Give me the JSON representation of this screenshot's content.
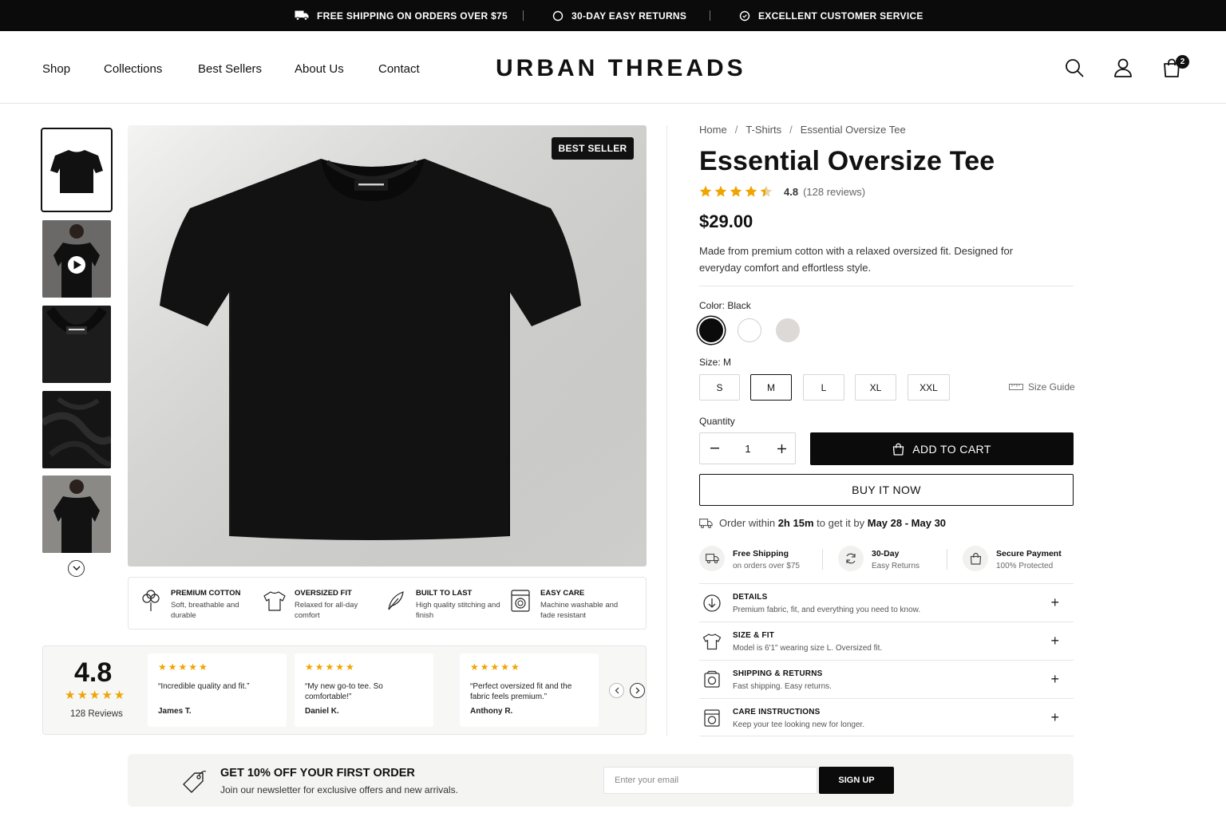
{
  "announcement": {
    "items": [
      {
        "icon": "truck-icon",
        "text": "FREE SHIPPING ON ORDERS OVER $75"
      },
      {
        "icon": "return-icon",
        "text": "30-DAY EASY RETURNS"
      },
      {
        "icon": "service-icon",
        "text": "EXCELLENT CUSTOMER SERVICE"
      }
    ]
  },
  "header": {
    "nav": [
      "Shop",
      "Collections",
      "Best Sellers",
      "About Us",
      "Contact"
    ],
    "logo": "URBAN THREADS",
    "cart_count": "2"
  },
  "gallery": {
    "thumbnails": [
      "tee-front",
      "model-video",
      "collar-detail",
      "fabric-closeup",
      "model-back"
    ],
    "badge": "BEST SELLER"
  },
  "features": [
    {
      "icon": "cotton-icon",
      "title": "PREMIUM COTTON",
      "desc": "Soft, breathable and durable"
    },
    {
      "icon": "tshirt-icon",
      "title": "OVERSIZED FIT",
      "desc": "Relaxed for all-day comfort"
    },
    {
      "icon": "feather-icon",
      "title": "BUILT TO LAST",
      "desc": "High quality stitching and finish"
    },
    {
      "icon": "washer-icon",
      "title": "EASY CARE",
      "desc": "Machine washable and fade resistant"
    }
  ],
  "reviews": {
    "average": "4.8",
    "stars": "★★★★★",
    "count_label": "128 Reviews",
    "items": [
      {
        "stars": "★★★★★",
        "quote": "“Incredible quality and fit.”",
        "author": "James T."
      },
      {
        "stars": "★★★★★",
        "quote": "“My new go-to tee. So comfortable!”",
        "author": "Daniel K."
      },
      {
        "stars": "★★★★★",
        "quote": "“Perfect oversized fit and the fabric feels premium.”",
        "author": "Anthony R."
      }
    ]
  },
  "product": {
    "breadcrumb": [
      "Home",
      "T-Shirts",
      "Essential Oversize Tee"
    ],
    "title": "Essential Oversize Tee",
    "rating": "4.8",
    "rating_stars": 4.8,
    "reviews_count": "(128 reviews)",
    "price": "$29.00",
    "description": "Made from premium cotton with a relaxed oversized fit. Designed for everyday comfort and effortless style.",
    "color_label": "Color: Black",
    "colors": [
      {
        "name": "Black",
        "hex": "#0b0b0b",
        "selected": true
      },
      {
        "name": "White",
        "hex": "#ffffff",
        "selected": false
      },
      {
        "name": "Stone",
        "hex": "#dcd9d6",
        "selected": false
      }
    ],
    "size_label": "Size: M",
    "sizes": [
      "S",
      "M",
      "L",
      "XL",
      "XXL"
    ],
    "selected_size": "M",
    "size_guide": "Size Guide",
    "quantity_label": "Quantity",
    "quantity": "1",
    "add_to_cart": "ADD TO CART",
    "buy_now": "BUY IT NOW",
    "delivery": {
      "pre": "Order within",
      "time": "2h 15m",
      "mid": "to get it by",
      "dates": "May 28 - May 30"
    }
  },
  "perks": [
    {
      "icon": "truck-icon",
      "title": "Free Shipping",
      "sub": "on orders over $75"
    },
    {
      "icon": "refresh-icon",
      "title": "30-Day",
      "sub": "Easy Returns"
    },
    {
      "icon": "lock-bag-icon",
      "title": "Secure Payment",
      "sub": "100% Protected"
    }
  ],
  "accordion": [
    {
      "icon": "arrow-down-circle-icon",
      "title": "DETAILS",
      "sub": "Premium fabric, fit, and everything you need to know."
    },
    {
      "icon": "tshirt-icon",
      "title": "SIZE & FIT",
      "sub": "Model is 6'1\" wearing size L. Oversized fit."
    },
    {
      "icon": "box-icon",
      "title": "SHIPPING & RETURNS",
      "sub": "Fast shipping. Easy returns."
    },
    {
      "icon": "washer-icon",
      "title": "CARE INSTRUCTIONS",
      "sub": "Keep your tee looking new for longer."
    }
  ],
  "newsletter": {
    "title": "GET 10% OFF YOUR FIRST ORDER",
    "desc": "Join our newsletter for exclusive offers and new arrivals.",
    "placeholder": "Enter your email",
    "button": "SIGN UP"
  },
  "colors": {
    "primary": "#0b0b0b",
    "star": "#f0a400",
    "border": "#e6e6e6"
  }
}
